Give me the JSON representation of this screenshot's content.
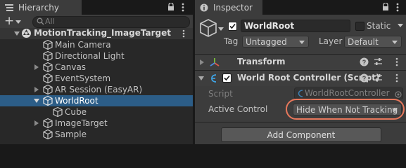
{
  "hierarchy": {
    "tab_label": "Hierarchy",
    "add_label": "+",
    "search_placeholder": "All",
    "scene_name": "MotionTracking_ImageTarget",
    "items": [
      {
        "label": "Main Camera"
      },
      {
        "label": "Directional Light"
      },
      {
        "label": "Canvas"
      },
      {
        "label": "EventSystem"
      },
      {
        "label": "AR Session (EasyAR)"
      },
      {
        "label": "WorldRoot"
      },
      {
        "label": "Cube"
      },
      {
        "label": "ImageTarget"
      },
      {
        "label": "Sample"
      }
    ]
  },
  "inspector": {
    "tab_label": "Inspector",
    "object_name": "WorldRoot",
    "static_label": "Static",
    "tag_label": "Tag",
    "tag_value": "Untagged",
    "layer_label": "Layer",
    "layer_value": "Default",
    "transform_label": "Transform",
    "component_label": "World Root Controller (Script)",
    "script_label": "Script",
    "script_value": "WorldRootController",
    "active_control_label": "Active Control",
    "active_control_value": "Hide When Not Tracking",
    "add_component_label": "Add Component"
  },
  "colors": {
    "selection": "#2c5d87",
    "highlight_ring": "#e8785c",
    "panel_bg": "#3c3c3c"
  }
}
